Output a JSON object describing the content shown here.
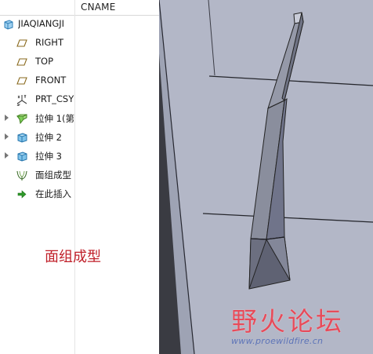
{
  "model_tree": {
    "root": "JIAQIANGJI",
    "column_header": "CNAME",
    "items": [
      {
        "label": "RIGHT",
        "icon": "datum-plane-icon",
        "expandable": false
      },
      {
        "label": "TOP",
        "icon": "datum-plane-icon",
        "expandable": false
      },
      {
        "label": "FRONT",
        "icon": "datum-plane-icon",
        "expandable": false
      },
      {
        "label": "PRT_CSY",
        "icon": "coordinate-system-icon",
        "expandable": false
      },
      {
        "label": "拉伸 1(第",
        "icon": "extrude-icon",
        "expandable": true
      },
      {
        "label": "拉伸 2",
        "icon": "extrude-icon",
        "expandable": true
      },
      {
        "label": "拉伸 3",
        "icon": "extrude-icon",
        "expandable": true
      },
      {
        "label": "面组成型",
        "icon": "boundary-blend-icon",
        "expandable": false
      },
      {
        "label": "在此插入",
        "icon": "insert-here-arrow-icon",
        "expandable": false
      }
    ]
  },
  "annotation": "面组成型",
  "viewport": {
    "background_color": "#3a3b42",
    "plate_color": "#b4b8c7",
    "watermark_text": "野火论坛",
    "watermark_url": "www.proewildfire.cn"
  }
}
